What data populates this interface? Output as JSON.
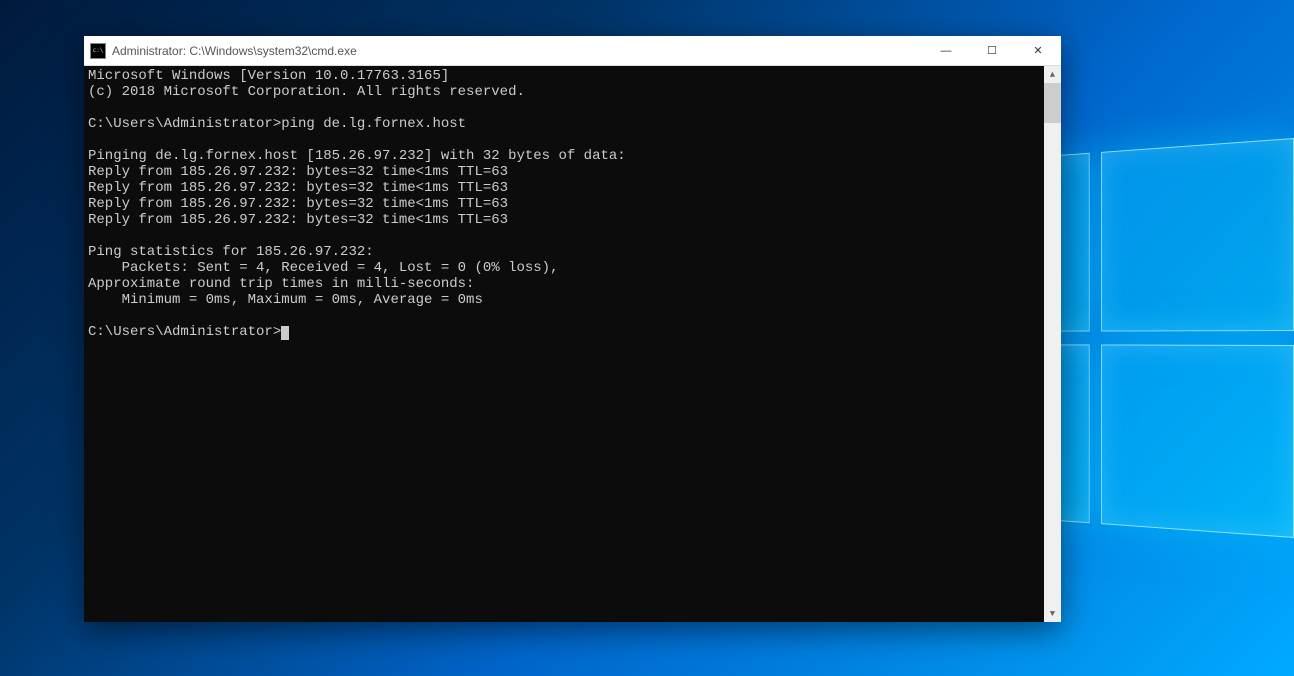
{
  "window": {
    "title": "Administrator: C:\\Windows\\system32\\cmd.exe"
  },
  "console": {
    "lines": [
      "Microsoft Windows [Version 10.0.17763.3165]",
      "(c) 2018 Microsoft Corporation. All rights reserved.",
      "",
      "C:\\Users\\Administrator>ping de.lg.fornex.host",
      "",
      "Pinging de.lg.fornex.host [185.26.97.232] with 32 bytes of data:",
      "Reply from 185.26.97.232: bytes=32 time<1ms TTL=63",
      "Reply from 185.26.97.232: bytes=32 time<1ms TTL=63",
      "Reply from 185.26.97.232: bytes=32 time<1ms TTL=63",
      "Reply from 185.26.97.232: bytes=32 time<1ms TTL=63",
      "",
      "Ping statistics for 185.26.97.232:",
      "    Packets: Sent = 4, Received = 4, Lost = 0 (0% loss),",
      "Approximate round trip times in milli-seconds:",
      "    Minimum = 0ms, Maximum = 0ms, Average = 0ms",
      "",
      "C:\\Users\\Administrator>"
    ]
  },
  "controls": {
    "minimize": "—",
    "maximize": "☐",
    "close": "✕"
  }
}
